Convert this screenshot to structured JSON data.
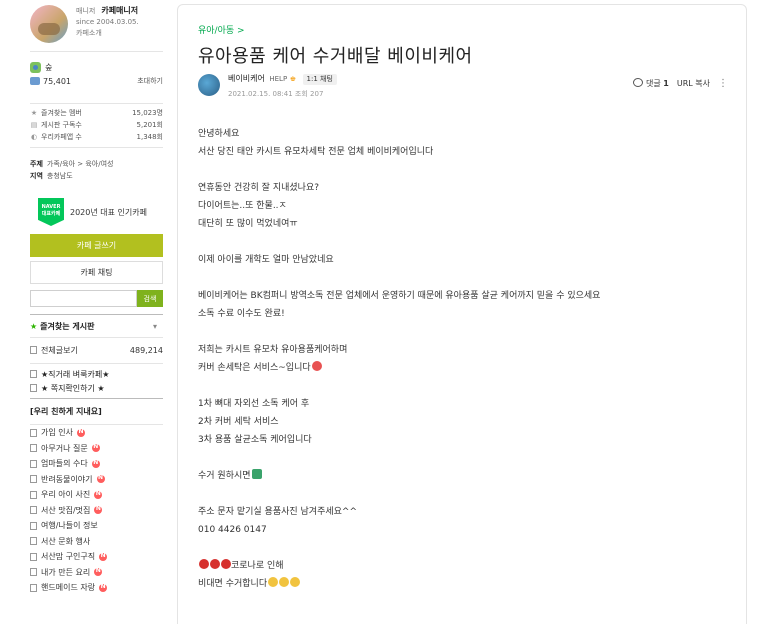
{
  "sidebar": {
    "manager_role": "매니저",
    "manager_name": "카페매니저",
    "since": "since 2004.03.05.",
    "cafe_info": "카페소개",
    "level_name": "숲",
    "member_count": "75,401",
    "invite": "초대하기",
    "stats": [
      {
        "label": "즐겨찾는 멤버",
        "value": "15,023명",
        "icon": "star-icon"
      },
      {
        "label": "게시판 구독수",
        "value": "5,201회",
        "icon": "board-icon"
      },
      {
        "label": "우리카페앱 수",
        "value": "1,348회",
        "icon": "app-icon"
      }
    ],
    "topic_label": "주제",
    "topic_value": "가족/육아 > 육아/여성",
    "region_label": "지역",
    "region_value": "충청남도",
    "naver_badge_line1": "NAVER",
    "naver_badge_line2": "대표카페",
    "naver_text": "2020년 대표 인기카페",
    "write_button": "카페 글쓰기",
    "chat_button": "카페 채팅",
    "search_placeholder": "",
    "search_button": "검색",
    "fav_title": "즐겨찾는 게시판",
    "all_posts_label": "전체글보기",
    "all_posts_count": "489,214",
    "top_menus": [
      "★직거래 벼룩카페★",
      "★ 쪽지확인하기 ★"
    ],
    "group_title": "[우리 친하게 지내요]",
    "boards": [
      {
        "label": "가입 인사",
        "new": true
      },
      {
        "label": "아무거나 질문",
        "new": true
      },
      {
        "label": "엄마들의 수다",
        "new": true
      },
      {
        "label": "반려동물이야기",
        "new": true
      },
      {
        "label": "우리 아이 사진",
        "new": true
      },
      {
        "label": "서산 맛집/멋집",
        "new": true
      },
      {
        "label": "여행/나들이 정보",
        "new": false
      },
      {
        "label": "서산 문화 행사",
        "new": false
      },
      {
        "label": "서산맘 구인구직",
        "new": true
      },
      {
        "label": "내가 만든 요리",
        "new": true
      },
      {
        "label": "핸드메이드 자랑",
        "new": true
      }
    ]
  },
  "article": {
    "board": "유아/아동 >",
    "title": "유아용품 케어 수거배달 베이비케어",
    "writer": "베이비케어",
    "writer_role": "HELP",
    "chat_chip": "1:1 채팅",
    "meta": "2021.02.15. 08:41  조회 207",
    "comment_label": "댓글",
    "comment_count": "1",
    "url_copy": "URL 복사",
    "lines": [
      "안녕하세요",
      "서산 당진 태안 카시트 유모차세탁 전문 업체 베이비케어입니다",
      "",
      "연휴동안 건강히 잘 지내셨나요?",
      "다이어트는..또 한물..ㅈ",
      "대단히 또 많이 먹었네여ㅠ",
      "",
      "이제 아이를 개학도 얼마 안남았네요",
      "",
      "베이비케어는 BK컴퍼니 방역소독 전문 업체에서 운영하기 때문에 유아용품 살균 케어까지 믿을 수 있으세요",
      "소독 수료 이수도 완료!",
      "",
      "저희는 카시트 유모차 유아용품케어하며",
      "커버 손세탁은 서비스~입니다",
      "",
      "1차 뼈대 자외선 소독 케어 후",
      "2차 커버 세탁 서비스",
      "3차 용품 살균소독 케어입니다",
      "",
      "수거 원하시면",
      "",
      "주소 문자 맡기실 용품사진 남겨주세요^^",
      "010 4426 0147",
      "",
      "코로나로 인해",
      "비대면 수거합니다"
    ]
  },
  "colors": {
    "accent": "#b2c01f",
    "link": "#03a94e",
    "new_badge": "#ff5d5d"
  }
}
